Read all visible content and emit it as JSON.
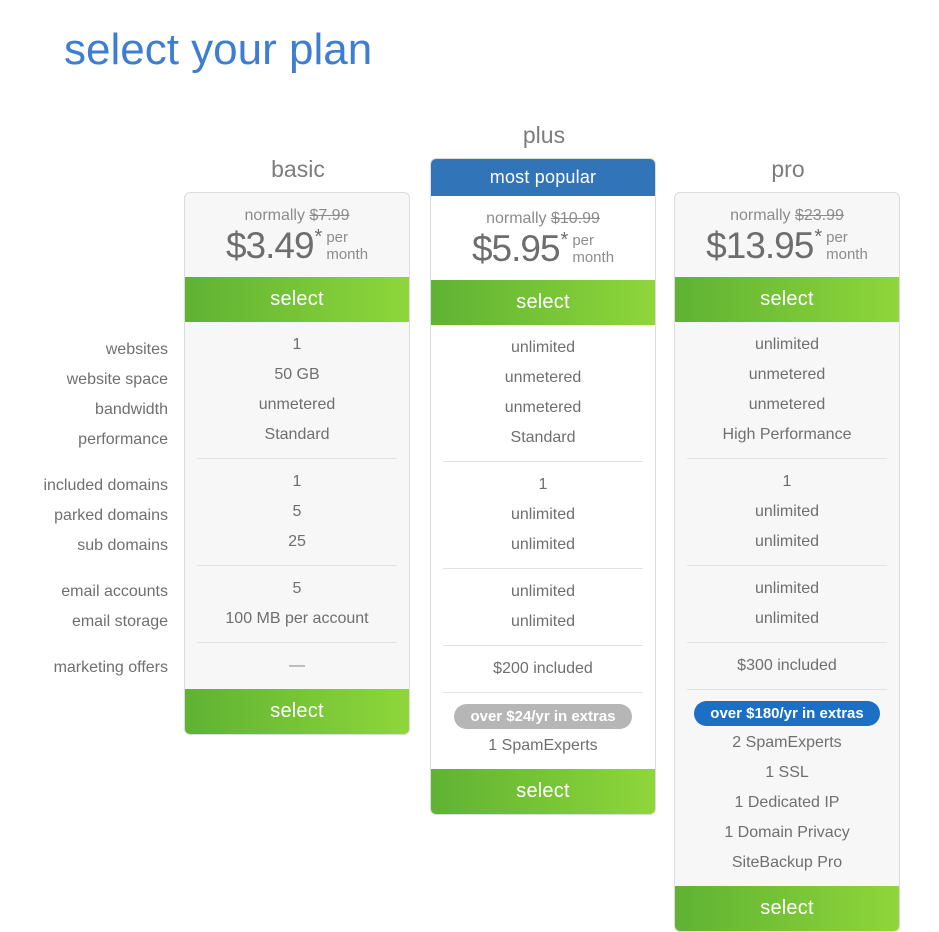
{
  "page": {
    "title": "select your plan"
  },
  "row_labels": {
    "group1": [
      "websites",
      "website space",
      "bandwidth",
      "performance"
    ],
    "group2": [
      "included domains",
      "parked domains",
      "sub domains"
    ],
    "group3": [
      "email accounts",
      "email storage"
    ],
    "group4": [
      "marketing offers"
    ]
  },
  "colors": {
    "title_blue": "#3d7dd2",
    "banner_blue": "#3175b8",
    "select_green_dark": "#5fb233",
    "select_green_light": "#8ed63a",
    "pill_gray": "#b6b6b6",
    "pill_blue": "#1b6fc4",
    "card_gray": "#f7f7f7",
    "card_white": "#ffffff",
    "text_gray": "#6f6f6f"
  },
  "plans": [
    {
      "name": "basic",
      "badge": null,
      "normally_label": "normally",
      "normally_price": "$7.99",
      "price": "$3.49",
      "star": "*",
      "per": "per",
      "month": "month",
      "select_top_label": "select",
      "select_bottom_label": "select",
      "group1": [
        "1",
        "50 GB",
        "unmetered",
        "Standard"
      ],
      "group2": [
        "1",
        "5",
        "25"
      ],
      "group3": [
        "5",
        "100 MB per account"
      ],
      "group4": [
        "—"
      ],
      "extras_pill": null,
      "extras": []
    },
    {
      "name": "plus",
      "badge": "most popular",
      "normally_label": "normally",
      "normally_price": "$10.99",
      "price": "$5.95",
      "star": "*",
      "per": "per",
      "month": "month",
      "select_top_label": "select",
      "select_bottom_label": "select",
      "group1": [
        "unlimited",
        "unmetered",
        "unmetered",
        "Standard"
      ],
      "group2": [
        "1",
        "unlimited",
        "unlimited"
      ],
      "group3": [
        "unlimited",
        "unlimited"
      ],
      "group4": [
        "$200 included"
      ],
      "extras_pill": "over $24/yr in extras",
      "extras": [
        "1 SpamExperts"
      ]
    },
    {
      "name": "pro",
      "badge": null,
      "normally_label": "normally",
      "normally_price": "$23.99",
      "price": "$13.95",
      "star": "*",
      "per": "per",
      "month": "month",
      "select_top_label": "select",
      "select_bottom_label": "select",
      "group1": [
        "unlimited",
        "unmetered",
        "unmetered",
        "High Performance"
      ],
      "group2": [
        "1",
        "unlimited",
        "unlimited"
      ],
      "group3": [
        "unlimited",
        "unlimited"
      ],
      "group4": [
        "$300 included"
      ],
      "extras_pill": "over $180/yr in extras",
      "extras": [
        "2 SpamExperts",
        "1 SSL",
        "1 Dedicated IP",
        "1 Domain Privacy",
        "SiteBackup Pro"
      ]
    }
  ]
}
